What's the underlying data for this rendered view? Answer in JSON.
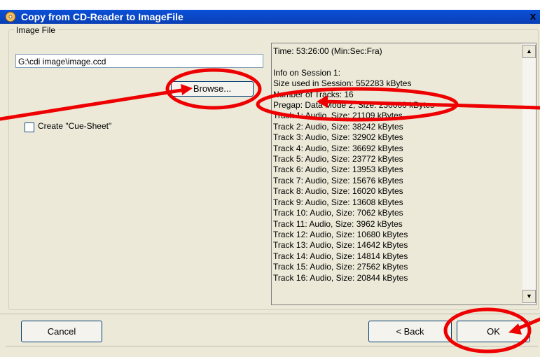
{
  "window": {
    "title": "Copy from CD-Reader to ImageFile",
    "close_label": "x"
  },
  "group": {
    "label": "Image File"
  },
  "path_field": {
    "value": "G:\\cdi image\\image.ccd"
  },
  "browse_button": {
    "label": "Browse..."
  },
  "cue_sheet": {
    "label": "Create \"Cue-Sheet\"",
    "checked": false
  },
  "info_lines": [
    "Time: 53:26:00 (Min:Sec:Fra)",
    "",
    "Info on Session 1:",
    "Size used in Session: 552283 kBytes",
    "Number of Tracks: 16",
    "Pregap: Data Mode 2, Size: 230000 kBytes",
    "Track 1: Audio, Size: 21109 kBytes",
    "Track 2: Audio, Size: 38242 kBytes",
    "Track 3: Audio, Size: 32902 kBytes",
    "Track 4: Audio, Size: 36692 kBytes",
    "Track 5: Audio, Size: 23772 kBytes",
    "Track 6: Audio, Size: 13953 kBytes",
    "Track 7: Audio, Size: 15676 kBytes",
    "Track 8: Audio, Size: 16020 kBytes",
    "Track 9: Audio, Size: 13608 kBytes",
    "Track 10: Audio, Size: 7062 kBytes",
    "Track 11: Audio, Size: 3962 kBytes",
    "Track 12: Audio, Size: 10680 kBytes",
    "Track 13: Audio, Size: 14642 kBytes",
    "Track 14: Audio, Size: 14814 kBytes",
    "Track 15: Audio, Size: 27562 kBytes",
    "Track 16: Audio, Size: 20844 kBytes"
  ],
  "buttons": {
    "cancel": "Cancel",
    "back": "< Back",
    "ok": "OK"
  },
  "colors": {
    "titlebar": "#0a46c8",
    "annotation": "#ee0000",
    "dialog_bg": "#ece9d8"
  },
  "icons": {
    "app": "cd-disc-icon",
    "scroll_up": "up-arrow-icon",
    "scroll_down": "down-arrow-icon"
  }
}
